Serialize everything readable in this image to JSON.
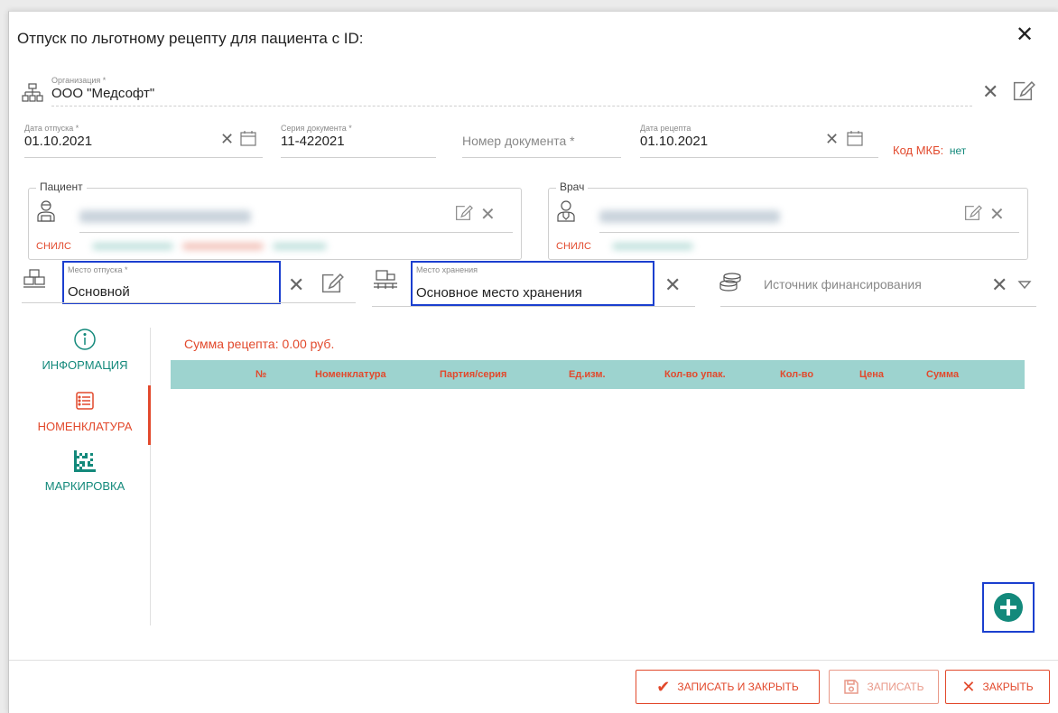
{
  "dialog": {
    "title": "Отпуск по льготному рецепту для пациента с ID:"
  },
  "organization": {
    "label": "Организация *",
    "value": "ООО \"Медсофт\""
  },
  "release_date": {
    "label": "Дата отпуска *",
    "value": "01.10.2021"
  },
  "doc_series": {
    "label": "Серия документа *",
    "value": "11-422021"
  },
  "doc_number": {
    "placeholder": "Номер документа *"
  },
  "recipe_date": {
    "label": "Дата рецепта",
    "value": "01.10.2021"
  },
  "mkb": {
    "label": "Код МКБ:",
    "value": "нет"
  },
  "patient": {
    "legend": "Пациент",
    "snils_label": "СНИЛС"
  },
  "doctor": {
    "legend": "Врач",
    "snils_label": "СНИЛС"
  },
  "release_place": {
    "label": "Место отпуска *",
    "value": "Основной"
  },
  "storage_place": {
    "label": "Место хранения",
    "value": "Основное место хранения"
  },
  "funding_source": {
    "placeholder": "Источник финансирования"
  },
  "sidebar": {
    "items": [
      {
        "label": "ИНФОРМАЦИЯ",
        "icon": "info-icon"
      },
      {
        "label": "НОМЕНКЛАТУРА",
        "icon": "list-icon",
        "active": true
      },
      {
        "label": "МАРКИРОВКА",
        "icon": "datamatrix-icon"
      }
    ]
  },
  "recipe_sum": "Сумма рецепта: 0.00 руб.",
  "table": {
    "columns": [
      "№",
      "Номенклатура",
      "Партия/серия",
      "Ед.изм.",
      "Кол-во упак.",
      "Кол-во",
      "Цена",
      "Сумма"
    ],
    "rows": []
  },
  "footer": {
    "save_close": "ЗАПИСАТЬ И ЗАКРЫТЬ",
    "save": "ЗАПИСАТЬ",
    "close": "ЗАКРЫТЬ"
  },
  "colors": {
    "accent_red": "#e2492c",
    "teal": "#13897b",
    "table_header": "#9dd3cf",
    "focus_border": "#1b3fcf"
  }
}
